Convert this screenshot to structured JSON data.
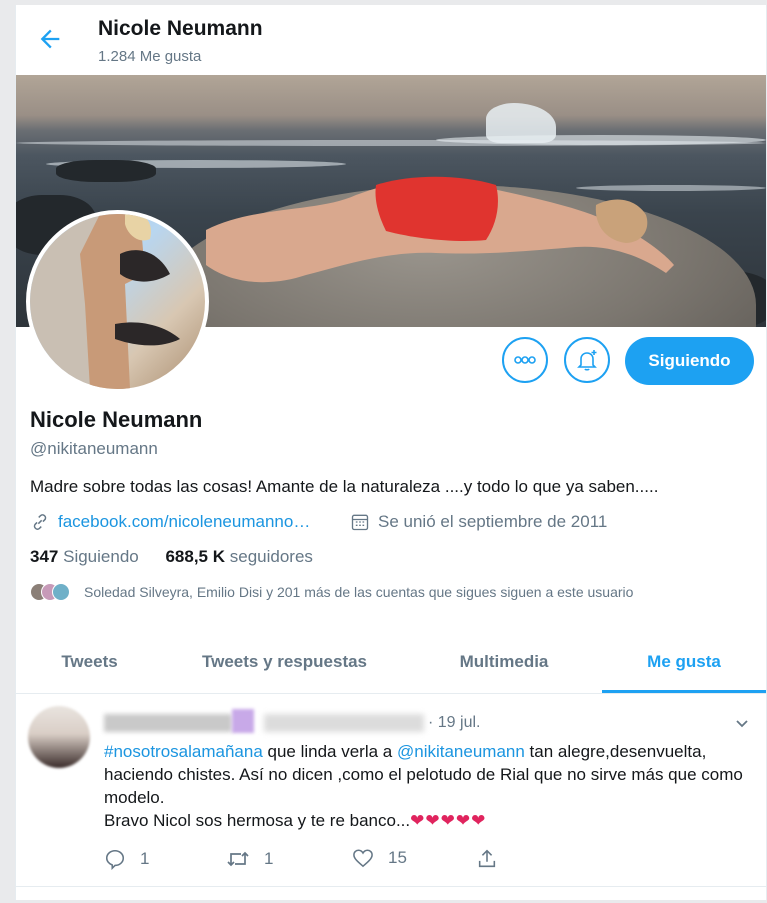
{
  "header": {
    "name": "Nicole Neumann",
    "likes_count": "1.284 Me gusta"
  },
  "profile": {
    "name": "Nicole Neumann",
    "handle": "@nikitaneumann",
    "bio": "Madre sobre todas las cosas! Amante de la naturaleza ....y todo lo que ya saben.....",
    "website": "facebook.com/nicoleneumanno…",
    "joined": "Se unió el septiembre de 2011",
    "following_count": "347",
    "following_label": "Siguiendo",
    "followers_count": "688,5 K",
    "followers_label": "seguidores",
    "mutual": "Soledad Silveyra, Emilio Disi y 201 más de las cuentas que sigues siguen a este usuario",
    "follow_button": "Siguiendo"
  },
  "tabs": [
    {
      "label": "Tweets"
    },
    {
      "label": "Tweets y respuestas"
    },
    {
      "label": "Multimedia"
    },
    {
      "label": "Me gusta"
    }
  ],
  "tweet": {
    "date": "· 19 jul.",
    "hashtag": "#nosotrosalamañana",
    "text_1": " que linda verla a ",
    "mention": "@nikitaneumann",
    "text_2": " tan alegre,desenvuelta, haciendo chistes. Así no dicen ,como el pelotudo de Rial que no sirve más que como modelo.",
    "text_3": "Bravo Nicol sos hermosa y te re banco...",
    "hearts": "❤❤❤❤❤",
    "replies": "1",
    "retweets": "1",
    "likes": "15"
  },
  "colors": {
    "accent": "#1da1f2",
    "heart": "#e0245e"
  }
}
